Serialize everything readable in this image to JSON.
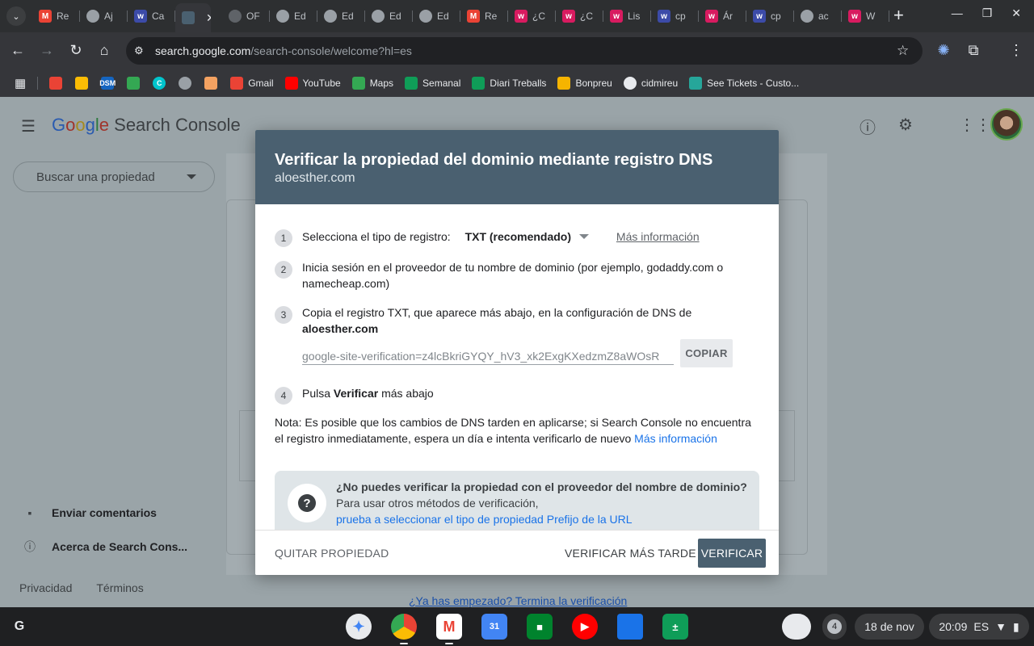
{
  "tabs": [
    {
      "title": "Re",
      "icon": "gmail-icon",
      "color": "#ea4335"
    },
    {
      "title": "Aj",
      "icon": "globe-icon",
      "color": "#9aa0a6"
    },
    {
      "title": "Ca",
      "icon": "w-icon",
      "color": "#3c4ba8"
    },
    {
      "title": "",
      "icon": "calendar-tab-icon",
      "color": "#4a6070",
      "active": true
    },
    {
      "title": "OF",
      "icon": "circle-icon",
      "color": "#5f6368"
    },
    {
      "title": "Ed",
      "icon": "globe-icon",
      "color": "#9aa0a6"
    },
    {
      "title": "Ed",
      "icon": "globe-icon",
      "color": "#9aa0a6"
    },
    {
      "title": "Ed",
      "icon": "globe-icon",
      "color": "#9aa0a6"
    },
    {
      "title": "Ed",
      "icon": "globe-icon",
      "color": "#9aa0a6"
    },
    {
      "title": "Re",
      "icon": "gmail-icon",
      "color": "#ea4335"
    },
    {
      "title": "¿C",
      "icon": "w-icon",
      "color": "#d81b60"
    },
    {
      "title": "¿C",
      "icon": "w-icon",
      "color": "#d81b60"
    },
    {
      "title": "Lis",
      "icon": "w-icon",
      "color": "#d81b60"
    },
    {
      "title": "cp",
      "icon": "w-icon",
      "color": "#3c4ba8"
    },
    {
      "title": "Ár",
      "icon": "w-icon",
      "color": "#d81b60"
    },
    {
      "title": "cp",
      "icon": "w-icon",
      "color": "#3c4ba8"
    },
    {
      "title": "ac",
      "icon": "globe-icon",
      "color": "#9aa0a6"
    },
    {
      "title": "W",
      "icon": "w-icon",
      "color": "#d81b60"
    }
  ],
  "address": {
    "host": "search.google.com",
    "path": "/search-console/welcome?hl=es"
  },
  "bookmarks": [
    {
      "label": "",
      "icon": "gmail-icon",
      "color": "#ea4335"
    },
    {
      "label": "",
      "icon": "pinwheel-icon",
      "color": "#fbbc04"
    },
    {
      "label": "",
      "icon": "dsm-icon",
      "color": "#1565c0",
      "text": "DSM"
    },
    {
      "label": "",
      "icon": "drive-icon",
      "color": "#34a853"
    },
    {
      "label": "",
      "icon": "canva-icon",
      "color": "#00c4cc",
      "text": "C"
    },
    {
      "label": "",
      "icon": "globe-icon",
      "color": "#9aa0a6"
    },
    {
      "label": "",
      "icon": "flower-icon",
      "color": "#f4a261"
    },
    {
      "label": "Gmail",
      "icon": "gmail-icon",
      "color": "#ea4335"
    },
    {
      "label": "YouTube",
      "icon": "youtube-icon",
      "color": "#ff0000"
    },
    {
      "label": "Maps",
      "icon": "maps-pin-icon",
      "color": "#34a853"
    },
    {
      "label": "Semanal",
      "icon": "sheets-icon",
      "color": "#0f9d58"
    },
    {
      "label": "Diari Treballs",
      "icon": "sheets-icon",
      "color": "#0f9d58"
    },
    {
      "label": "Bonpreu",
      "icon": "bonpreu-icon",
      "color": "#f6b400"
    },
    {
      "label": "cidmireu",
      "icon": "wordpress-icon",
      "color": "#e8eaed"
    },
    {
      "label": "See Tickets - Custo...",
      "icon": "seetickets-icon",
      "color": "#26a69a"
    }
  ],
  "gsc": {
    "logo_google": [
      "G",
      "o",
      "o",
      "g",
      "l",
      "e"
    ],
    "logo_product": "Search Console",
    "search_property": "Buscar una propiedad",
    "feedback": "Enviar comentarios",
    "about": "Acerca de Search Cons...",
    "privacy": "Privacidad",
    "terms": "Términos",
    "bottom_link": "¿Ya has empezado? Termina la verificación"
  },
  "modal": {
    "title": "Verificar la propiedad del dominio mediante registro DNS",
    "domain": "aloesther.com",
    "step1": {
      "num": "1",
      "label": "Selecciona el tipo de registro:",
      "record_type": "TXT (recomendado)",
      "more_info": "Más información"
    },
    "step2": {
      "num": "2",
      "text": "Inicia sesión en el proveedor de tu nombre de dominio (por ejemplo, godaddy.com o namecheap.com)"
    },
    "step3": {
      "num": "3",
      "text": "Copia el registro TXT, que aparece más abajo, en la configuración de DNS de ",
      "domain": "aloesther.com"
    },
    "txt_record": "google-site-verification=z4lcBkriGYQY_hV3_xk2ExgKXedzmZ8aWOsR",
    "copy": "COPIAR",
    "step4": {
      "num": "4",
      "pre": "Pulsa ",
      "bold": "Verificar",
      "post": " más abajo"
    },
    "note": "Nota: Es posible que los cambios de DNS tarden en aplicarse; si Search Console no encuentra el registro inmediatamente, espera un día e intenta verificarlo de nuevo ",
    "note_link": "Más información",
    "help": {
      "question": "¿No puedes verificar la propiedad con el proveedor del nombre de dominio?",
      "text": "Para usar otros métodos de verificación,",
      "link": "prueba a seleccionar el tipo de propiedad Prefijo de la URL"
    },
    "buttons": {
      "remove": "QUITAR PROPIEDAD",
      "later": "VERIFICAR MÁS TARDE",
      "verify": "VERIFICAR"
    }
  },
  "shelf": {
    "apps": [
      {
        "name": "gemini-icon",
        "color": "#e8eaed"
      },
      {
        "name": "chrome-icon",
        "color": "#e8eaed"
      },
      {
        "name": "gmail-icon",
        "color": "#ffffff"
      },
      {
        "name": "calendar-icon",
        "color": "#4285f4",
        "text": "31"
      },
      {
        "name": "meet-icon",
        "color": "#00832d"
      },
      {
        "name": "youtube-icon",
        "color": "#ff0000"
      },
      {
        "name": "files-icon",
        "color": "#1a73e8"
      },
      {
        "name": "sheets-calc-icon",
        "color": "#0f9d58"
      }
    ],
    "notifications": "4",
    "date": "18 de nov",
    "time": "20:09",
    "locale": "ES"
  }
}
